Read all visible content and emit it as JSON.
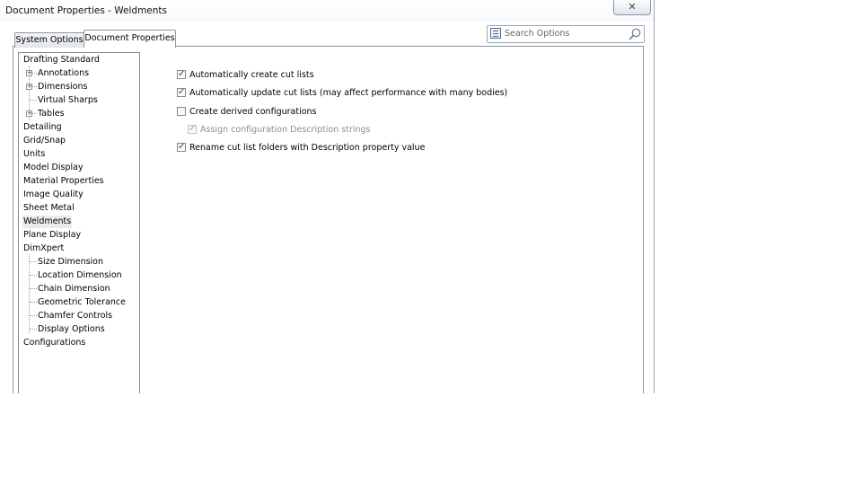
{
  "window": {
    "title": "Document Properties - Weldments",
    "close_glyph": "✕"
  },
  "tabs": [
    {
      "label": "System Options",
      "active": false
    },
    {
      "label": "Document Properties",
      "active": true
    }
  ],
  "search": {
    "placeholder": "Search Options",
    "list_icon": "options-list-icon",
    "search_icon": "magnifier-icon"
  },
  "tree": {
    "selected": "Weldments",
    "items": [
      {
        "label": "Drafting Standard"
      },
      {
        "label": "Annotations"
      },
      {
        "label": "Dimensions"
      },
      {
        "label": "Virtual Sharps"
      },
      {
        "label": "Tables"
      },
      {
        "label": "Detailing"
      },
      {
        "label": "Grid/Snap"
      },
      {
        "label": "Units"
      },
      {
        "label": "Model Display"
      },
      {
        "label": "Material Properties"
      },
      {
        "label": "Image Quality"
      },
      {
        "label": "Sheet Metal"
      },
      {
        "label": "Weldments"
      },
      {
        "label": "Plane Display"
      },
      {
        "label": "DimXpert"
      },
      {
        "label": "Size Dimension"
      },
      {
        "label": "Location Dimension"
      },
      {
        "label": "Chain Dimension"
      },
      {
        "label": "Geometric Tolerance"
      },
      {
        "label": "Chamfer Controls"
      },
      {
        "label": "Display Options"
      },
      {
        "label": "Configurations"
      }
    ]
  },
  "options": [
    {
      "label": "Automatically create cut lists",
      "checked": true,
      "enabled": true
    },
    {
      "label": "Automatically update cut lists (may affect performance with many bodies)",
      "checked": true,
      "enabled": true
    },
    {
      "label": "Create derived configurations",
      "checked": false,
      "enabled": true
    },
    {
      "label": "Assign configuration Description strings",
      "checked": true,
      "enabled": false
    },
    {
      "label": "Rename cut list folders with Description property value",
      "checked": true,
      "enabled": true
    }
  ]
}
